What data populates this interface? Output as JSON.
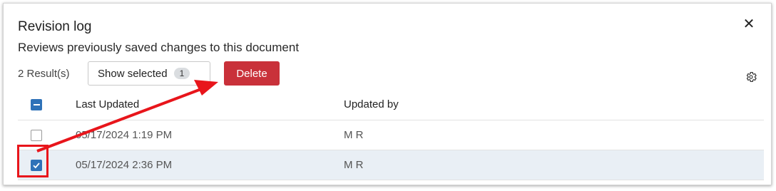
{
  "dialog": {
    "title": "Revision log",
    "subtitle": "Reviews previously saved changes to this document",
    "close_icon": "close-icon"
  },
  "toolbar": {
    "result_count": "2 Result(s)",
    "show_selected_label": "Show selected",
    "selected_count": "1",
    "delete_label": "Delete",
    "settings_icon": "gear-icon"
  },
  "table": {
    "columns": [
      "Last Updated",
      "Updated by"
    ],
    "header_checkbox_state": "indeterminate",
    "rows": [
      {
        "last_updated": "05/17/2024 1:19 PM",
        "updated_by": "M R",
        "checked": false
      },
      {
        "last_updated": "05/17/2024 2:36 PM",
        "updated_by": "M R",
        "checked": true
      }
    ]
  },
  "colors": {
    "delete": "#c9313a",
    "checkbox_accent": "#2f72b8",
    "selected_row": "#e9eff5",
    "annotation": "#e8151b"
  }
}
